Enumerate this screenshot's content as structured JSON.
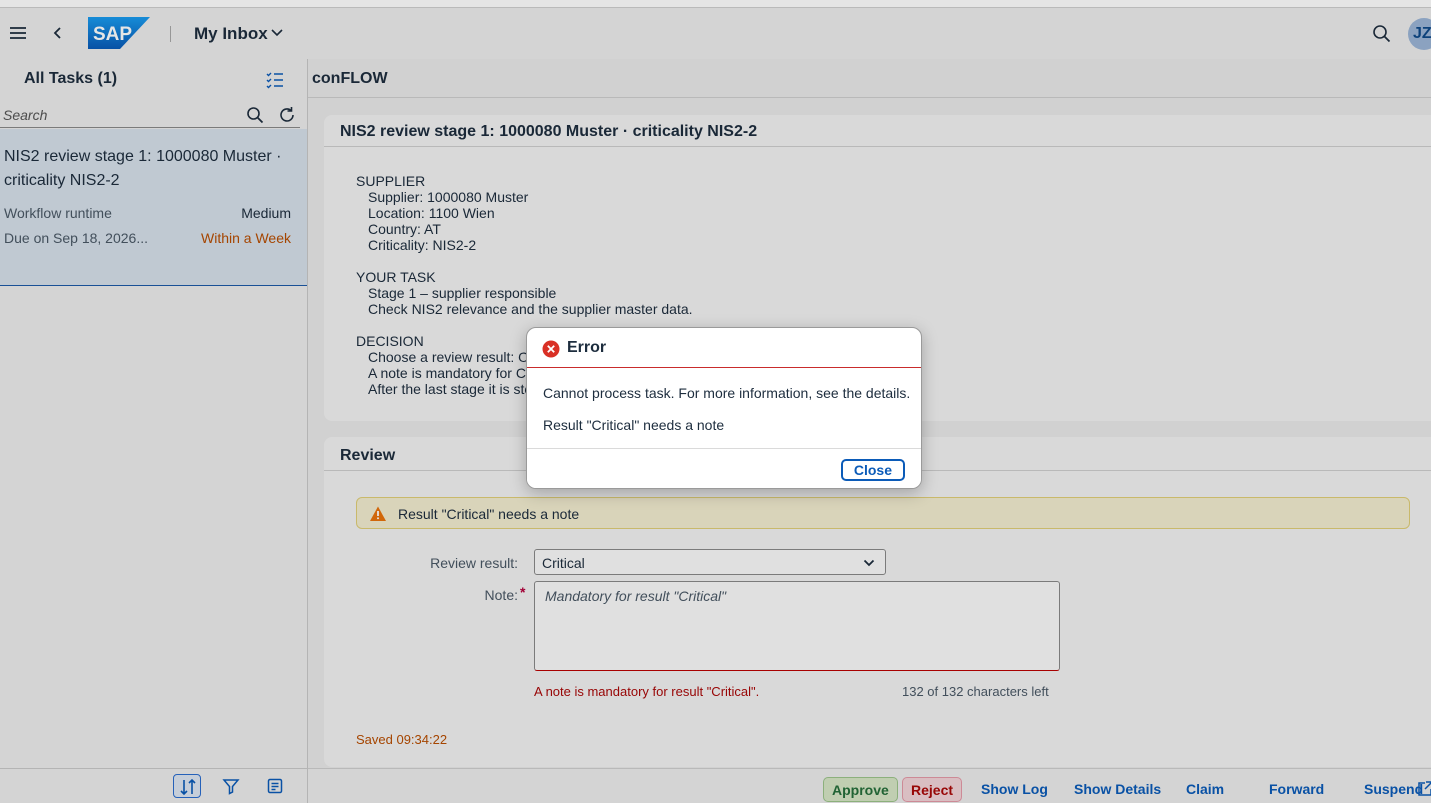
{
  "shell": {
    "logo_text": "SAP",
    "app_title": "My Inbox",
    "avatar_initials": "JZ"
  },
  "master": {
    "title": "All Tasks (1)",
    "search_placeholder": "Search",
    "tasks": [
      {
        "title": "NIS2 review stage 1: 1000080 Muster · criticality NIS2-2",
        "subtitle": "Workflow runtime",
        "priority": "Medium",
        "due": "Due on Sep 18, 2026...",
        "status": "Within a Week",
        "status_color": "#b84d00"
      }
    ]
  },
  "detail": {
    "header_title": "conFLOW",
    "card1": {
      "title": "NIS2 review stage 1: 1000080 Muster  · criticality NIS2-2",
      "sections": [
        {
          "heading": "SUPPLIER",
          "lines": [
            "Supplier: 1000080 Muster",
            "Location: 1100 Wien",
            "Country: AT",
            "Criticality: NIS2-2"
          ]
        },
        {
          "heading": "YOUR TASK",
          "lines": [
            "Stage 1 – supplier responsible",
            "Check NIS2 relevance and the supplier master data."
          ]
        },
        {
          "heading": "DECISION",
          "lines": [
            "Choose a review result: O",
            "A note is mandatory for C",
            "After the last stage it is sto"
          ]
        }
      ]
    },
    "review": {
      "title": "Review",
      "warning_text": "Result \"Critical\" needs a note",
      "result_label": "Review result:",
      "result_value": "Critical",
      "note_label": "Note:",
      "note_required_mark": "*",
      "note_placeholder": "Mandatory for result \"Critical\"",
      "note_error": "A note is mandatory for result \"Critical\".",
      "char_count": "132 of 132 characters left",
      "saved_text": "Saved 09:34:22"
    },
    "footer": {
      "approve": "Approve",
      "reject": "Reject",
      "show_log": "Show Log",
      "show_details": "Show Details",
      "claim": "Claim",
      "forward": "Forward",
      "suspend": "Suspend"
    }
  },
  "dialog": {
    "title": "Error",
    "message": "Cannot process task. For more information, see the details.",
    "detail": "Result \"Critical\" needs a note",
    "close_label": "Close"
  },
  "colors": {
    "brand_blue": "#0b5bb8",
    "error_red": "#c92c2c",
    "warning": "#e9730c"
  }
}
